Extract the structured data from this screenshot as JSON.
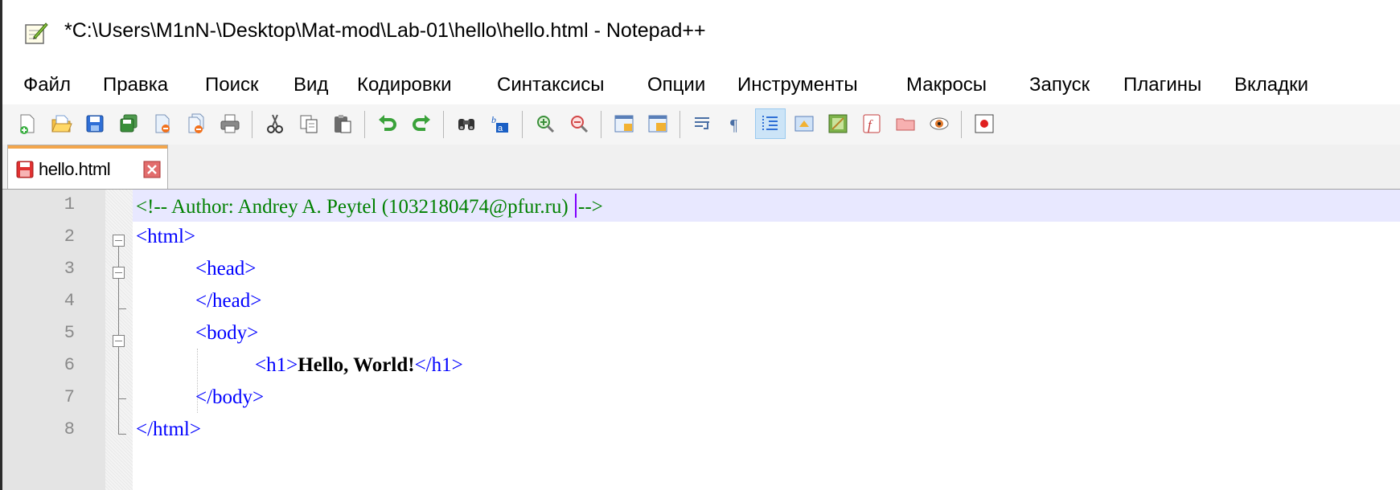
{
  "window": {
    "title": "*C:\\Users\\M1nN-\\Desktop\\Mat-mod\\Lab-01\\hello\\hello.html - Notepad++"
  },
  "menu": {
    "items": [
      "Файл",
      "Правка",
      "Поиск",
      "Вид",
      "Кодировки",
      "Синтаксисы",
      "Опции",
      "Инструменты",
      "Макросы",
      "Запуск",
      "Плагины",
      "Вкладки"
    ]
  },
  "toolbar": {
    "buttons": [
      "new-file-icon",
      "open-file-icon",
      "save-icon",
      "save-all-icon",
      "close-icon",
      "close-all-icon",
      "print-icon",
      "cut-icon",
      "copy-icon",
      "paste-icon",
      "undo-icon",
      "redo-icon",
      "find-icon",
      "replace-icon",
      "zoom-in-icon",
      "zoom-out-icon",
      "sync-vertical-icon",
      "sync-horizontal-icon",
      "word-wrap-icon",
      "show-all-chars-icon",
      "indent-guide-icon",
      "define-language-icon",
      "document-map-icon",
      "function-list-icon",
      "folder-workspace-icon",
      "monitoring-icon",
      "record-macro-icon"
    ]
  },
  "tabs": [
    {
      "label": "hello.html"
    }
  ],
  "editor": {
    "lines": [
      {
        "number": "1",
        "text": "<!-- Author: Andrey A. Peytel (1032180474@pfur.ru) -->"
      },
      {
        "number": "2",
        "text": "<html>"
      },
      {
        "number": "3",
        "text": "<head>"
      },
      {
        "number": "4",
        "text": "</head>"
      },
      {
        "number": "5",
        "text": "<body>"
      },
      {
        "number": "6",
        "text": "<h1>Hello, World!</h1>"
      },
      {
        "number": "7",
        "text": "</body>"
      },
      {
        "number": "8",
        "text": "</html>"
      }
    ],
    "code": {
      "l1_comment_a": "<!-- Author: Andrey A. Peytel (1032180474@pfur.ru) ",
      "l1_comment_b": "-->",
      "l2_tag": "<html>",
      "l3_tag": "<head>",
      "l4_tag": "</head>",
      "l5_tag": "<body>",
      "l6_open": "<h1>",
      "l6_text": "Hello, World!",
      "l6_close": "</h1>",
      "l7_tag": "</body>",
      "l8_tag": "</html>"
    }
  },
  "colors": {
    "comment": "#008000",
    "tag": "#0000ff",
    "current_line": "#e8e8ff",
    "tab_accent": "#f3a64c"
  }
}
